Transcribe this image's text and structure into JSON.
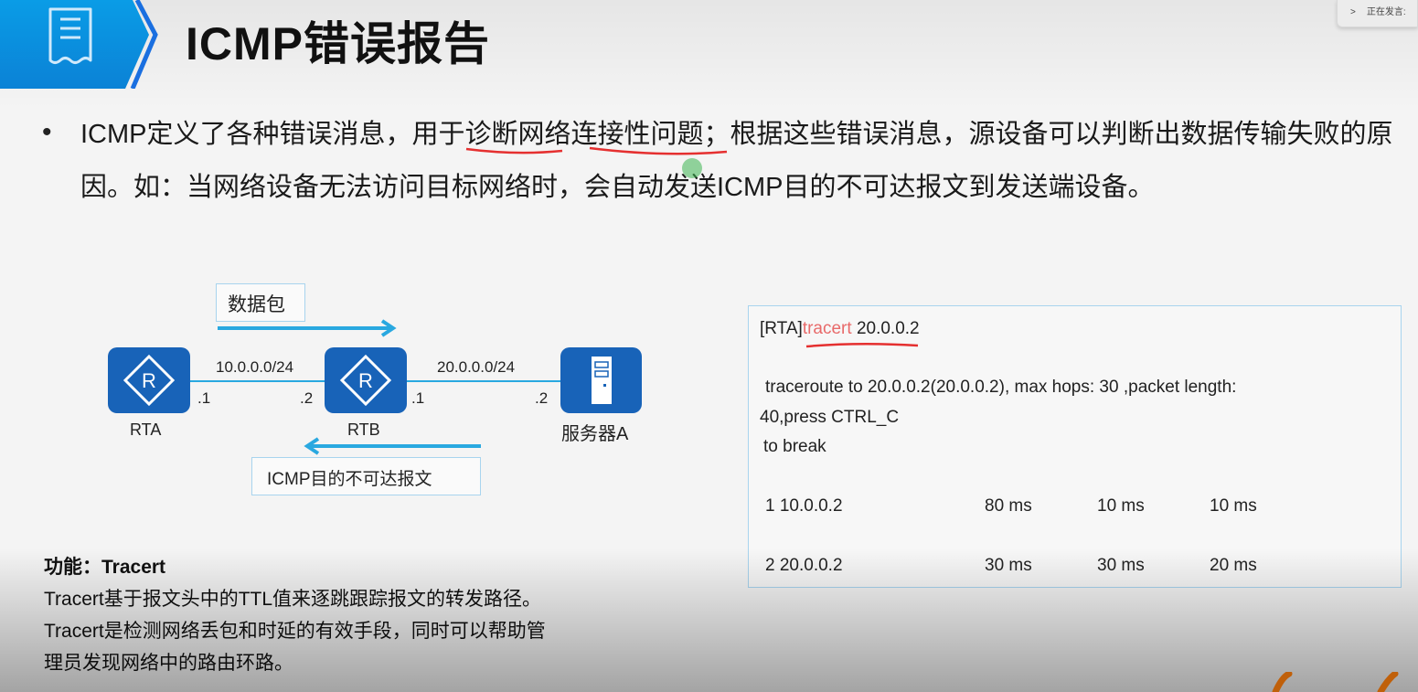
{
  "header": {
    "title": "ICMP错误报告",
    "icon": "receipt-icon"
  },
  "overlay": {
    "speaking_label": "正在发言:"
  },
  "body": {
    "bullet": "•",
    "paragraph": "ICMP定义了各种错误消息，用于诊断网络连接性问题；根据这些错误消息，源设备可以判断出数据传输失败的原因。如：当网络设备无法访问目标网络时，会自动发送ICMP目的不可达报文到发送端设备。"
  },
  "diagram": {
    "packet_label": "数据包",
    "icmp_label": "ICMP目的不可达报文",
    "net1": "10.0.0.0/24",
    "net2": "20.0.0.0/24",
    "rta": "RTA",
    "rtb": "RTB",
    "server": "服务器A",
    "ip_rta": ".1",
    "ip_rtb_left": ".2",
    "ip_rtb_right": ".1",
    "ip_server": ".2",
    "accent": "#1863b8",
    "link_color": "#29a8e0"
  },
  "terminal": {
    "prompt": "[RTA]",
    "command": "tracert",
    "target": " 20.0.0.2",
    "line1": "traceroute to  20.0.0.2(20.0.0.2), max hops: 30 ,packet length:",
    "line2": "40,press CTRL_C",
    "line3": " to break",
    "hops": [
      {
        "hop": "1 10.0.0.2",
        "t1": "80 ms",
        "t2": "10 ms",
        "t3": "10 ms"
      },
      {
        "hop": "2 20.0.0.2",
        "t1": "30 ms",
        "t2": "30 ms",
        "t3": "20 ms"
      }
    ]
  },
  "function": {
    "heading": "功能：Tracert",
    "line1": "Tracert基于报文头中的TTL值来逐跳跟踪报文的转发路径。",
    "line2": "Tracert是检测网络丢包和时延的有效手段，同时可以帮助管",
    "line3": "理员发现网络中的路由环路。"
  }
}
